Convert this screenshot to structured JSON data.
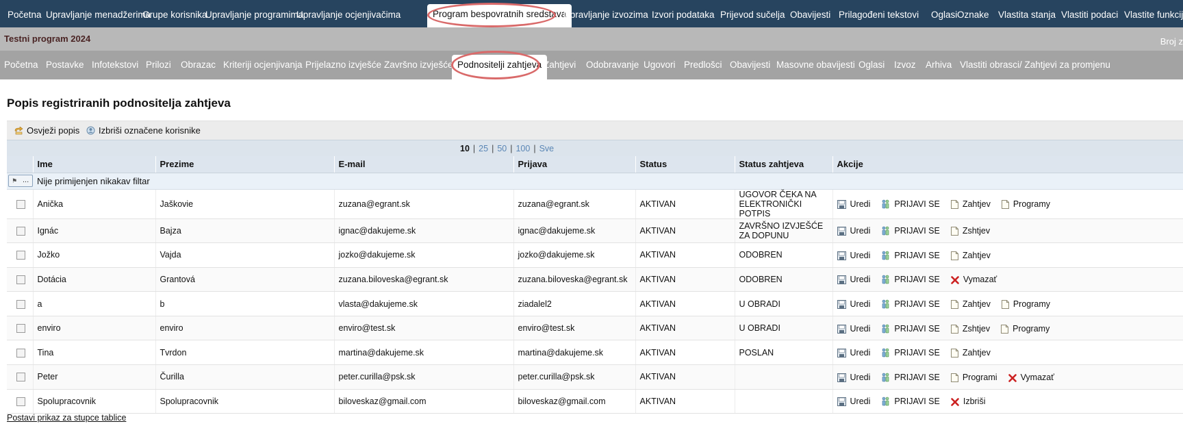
{
  "top_nav": {
    "items": [
      {
        "label": "Početna",
        "active": false
      },
      {
        "label": "Upravljanje menadžerima",
        "active": false
      },
      {
        "label": "Grupe korisnika",
        "active": false
      },
      {
        "label": "Upravljanje programima",
        "active": false
      },
      {
        "label": "Upravljanje ocjenjivačima",
        "active": false
      },
      {
        "label": "Program bespovratnih sredstava",
        "active": true
      },
      {
        "label": "Upravljanje izvozima",
        "active": false
      },
      {
        "label": "Izvori podataka",
        "active": false
      },
      {
        "label": "Prijevod sučelja",
        "active": false
      },
      {
        "label": "Obavijesti",
        "active": false
      },
      {
        "label": "Prilagođeni tekstovi",
        "active": false
      },
      {
        "label": "Oglasi",
        "active": false
      },
      {
        "label": "Oznake",
        "active": false
      },
      {
        "label": "Vlastita stanja",
        "active": false
      },
      {
        "label": "Vlastiti podaci",
        "active": false
      },
      {
        "label": "Vlastite funkcije",
        "active": false
      }
    ]
  },
  "program_bar": {
    "title": "Testni program 2024",
    "right_text": "Broj z"
  },
  "sub_nav": {
    "items": [
      {
        "label": "Početna",
        "active": false
      },
      {
        "label": "Postavke",
        "active": false
      },
      {
        "label": "Infotekstovi",
        "active": false
      },
      {
        "label": "Prilozi",
        "active": false
      },
      {
        "label": "Obrazac",
        "active": false
      },
      {
        "label": "Kriteriji ocjenjivanja",
        "active": false
      },
      {
        "label": "Prijelazno izvješće",
        "active": false
      },
      {
        "label": "Završno izvješće",
        "active": false
      },
      {
        "label": "Podnositelji zahtjeva",
        "active": true
      },
      {
        "label": "Zahtjevi",
        "active": false
      },
      {
        "label": "Odobravanje",
        "active": false
      },
      {
        "label": "Ugovori",
        "active": false
      },
      {
        "label": "Predlošci",
        "active": false
      },
      {
        "label": "Obavijesti",
        "active": false
      },
      {
        "label": "Masovne obavijesti",
        "active": false
      },
      {
        "label": "Oglasi",
        "active": false
      },
      {
        "label": "Izvoz",
        "active": false
      },
      {
        "label": "Arhiva",
        "active": false
      },
      {
        "label": "Vlastiti obrasci/ Zahtjevi za promjenu",
        "active": false
      }
    ]
  },
  "page": {
    "title": "Popis registriranih podnositelja zahtjeva",
    "toolbar": {
      "refresh_label": "Osvježi popis",
      "delete_label": "Izbriši označene korisnike"
    },
    "pager": {
      "options": [
        "10",
        "25",
        "50",
        "100",
        "Sve"
      ],
      "selected": "10"
    },
    "columns": [
      "",
      "Ime",
      "Prezime",
      "E-mail",
      "Prijava",
      "Status",
      "Status zahtjeva",
      "Akcije"
    ],
    "filter_text": "Nije primijenjen nikakav filtar",
    "filter_button_dots": "...",
    "rows": [
      {
        "ime": "Anička",
        "prezime": "Jaškovie",
        "email": "zuzana@egrant.sk",
        "prijava": "zuzana@egrant.sk",
        "status": "AKTIVAN",
        "status_zahtjeva": "UGOVOR ČEKA NA ELEKTRONIČKI POTPIS",
        "actions": [
          {
            "type": "edit",
            "label": "Uredi"
          },
          {
            "type": "login",
            "label": "PRIJAVI SE"
          },
          {
            "type": "doc",
            "label": "Zahtjev"
          },
          {
            "type": "doc",
            "label": "Programy"
          }
        ]
      },
      {
        "ime": "Ignác",
        "prezime": "Bajza",
        "email": "ignac@dakujeme.sk",
        "prijava": "ignac@dakujeme.sk",
        "status": "AKTIVAN",
        "status_zahtjeva": "ZAVRŠNO IZVJEŠĆE ZA DOPUNU",
        "actions": [
          {
            "type": "edit",
            "label": "Uredi"
          },
          {
            "type": "login",
            "label": "PRIJAVI SE"
          },
          {
            "type": "doc",
            "label": "Zshtjev"
          }
        ]
      },
      {
        "ime": "Jožko",
        "prezime": "Vajda",
        "email": "jozko@dakujeme.sk",
        "prijava": "jozko@dakujeme.sk",
        "status": "AKTIVAN",
        "status_zahtjeva": "ODOBREN",
        "actions": [
          {
            "type": "edit",
            "label": "Uredi"
          },
          {
            "type": "login",
            "label": "PRIJAVI SE"
          },
          {
            "type": "doc",
            "label": "Zahtjev"
          }
        ]
      },
      {
        "ime": "Dotácia",
        "prezime": "Grantová",
        "email": "zuzana.biloveska@egrant.sk",
        "prijava": "zuzana.biloveska@egrant.sk",
        "status": "AKTIVAN",
        "status_zahtjeva": "ODOBREN",
        "actions": [
          {
            "type": "edit",
            "label": "Uredi"
          },
          {
            "type": "login",
            "label": "PRIJAVI SE"
          },
          {
            "type": "delete",
            "label": "Vymazať"
          }
        ]
      },
      {
        "ime": "a",
        "prezime": "b",
        "email": "vlasta@dakujeme.sk",
        "prijava": "ziadalel2",
        "status": "AKTIVAN",
        "status_zahtjeva": "U OBRADI",
        "actions": [
          {
            "type": "edit",
            "label": "Uredi"
          },
          {
            "type": "login",
            "label": "PRIJAVI SE"
          },
          {
            "type": "doc",
            "label": "Zahtjev"
          },
          {
            "type": "doc",
            "label": "Programy"
          }
        ]
      },
      {
        "ime": "enviro",
        "prezime": "enviro",
        "email": "enviro@test.sk",
        "prijava": "enviro@test.sk",
        "status": "AKTIVAN",
        "status_zahtjeva": "U OBRADI",
        "actions": [
          {
            "type": "edit",
            "label": "Uredi"
          },
          {
            "type": "login",
            "label": "PRIJAVI SE"
          },
          {
            "type": "doc",
            "label": "Zshtjev"
          },
          {
            "type": "doc",
            "label": "Programy"
          }
        ]
      },
      {
        "ime": "Tina",
        "prezime": "Tvrdon",
        "email": "martina@dakujeme.sk",
        "prijava": "martina@dakujeme.sk",
        "status": "AKTIVAN",
        "status_zahtjeva": "POSLAN",
        "actions": [
          {
            "type": "edit",
            "label": "Uredi"
          },
          {
            "type": "login",
            "label": "PRIJAVI SE"
          },
          {
            "type": "doc",
            "label": "Zahtjev"
          }
        ]
      },
      {
        "ime": "Peter",
        "prezime": "Čurilla",
        "email": "peter.curilla@psk.sk",
        "prijava": "peter.curilla@psk.sk",
        "status": "AKTIVAN",
        "status_zahtjeva": "",
        "actions": [
          {
            "type": "edit",
            "label": "Uredi"
          },
          {
            "type": "login",
            "label": "PRIJAVI SE"
          },
          {
            "type": "doc",
            "label": "Programi"
          },
          {
            "type": "delete",
            "label": "Vymazať"
          }
        ]
      },
      {
        "ime": "Spolupracovnik",
        "prezime": "Spolupracovnik",
        "email": "biloveskaz@gmail.com",
        "prijava": "biloveskaz@gmail.com",
        "status": "AKTIVAN",
        "status_zahtjeva": "",
        "actions": [
          {
            "type": "edit",
            "label": "Uredi"
          },
          {
            "type": "login",
            "label": "PRIJAVI SE"
          },
          {
            "type": "delete",
            "label": "Izbriši"
          }
        ]
      }
    ],
    "footer_link": "Postavi prikaz za stupce tablice"
  },
  "colors": {
    "top_nav_bg": "#27445f",
    "program_bar_bg": "#b8b8b8",
    "sub_nav_bg": "#a3a3a3",
    "highlight_ellipse": "#d96a6a",
    "delete_red": "#cc2222",
    "pager_link": "#5a86b5"
  }
}
